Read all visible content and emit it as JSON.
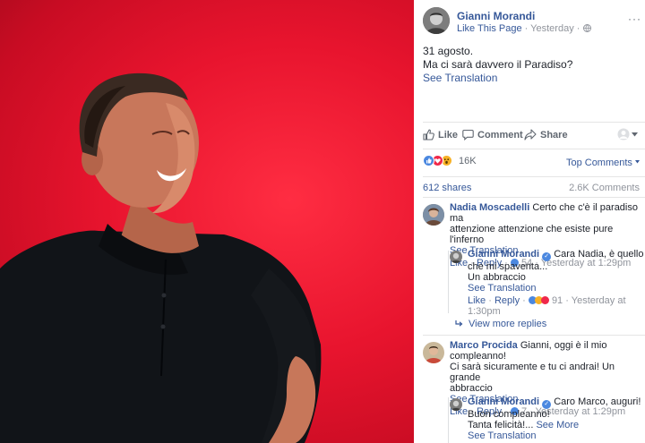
{
  "post": {
    "author": "Gianni Morandi",
    "like_page": "Like This Page",
    "time": "Yesterday",
    "dot": "·",
    "more": "···",
    "text_line1": "31 agosto.",
    "text_line2": "Ma ci sarà davvero il Paradiso?",
    "see_translation": "See Translation"
  },
  "actions": {
    "like": "Like",
    "comment": "Comment",
    "share": "Share"
  },
  "stats": {
    "reactions_count": "16K",
    "top_comments": "Top Comments",
    "shares": "612 shares",
    "comments_count": "2.6K Comments"
  },
  "comments": [
    {
      "name": "Nadia Moscadelli",
      "text_a": "Certo che c'è il paradiso ma",
      "text_b": "attenzione attenzione che esiste pure l'inferno",
      "see_translation": "See Translation",
      "like": "Like",
      "reply": "Reply",
      "reactions": "54",
      "time": "Yesterday at 1:29pm"
    },
    {
      "name": "Gianni Morandi",
      "text_a": "Cara Nadia, è quello",
      "text_b": "che mi spaventa...",
      "text_c": "Un abbraccio",
      "see_translation": "See Translation",
      "like": "Like",
      "reply": "Reply",
      "reactions": "91",
      "time_a": "Yesterday at",
      "time_b": "1:30pm"
    },
    {
      "view_more": "View more replies"
    },
    {
      "name": "Marco Procida",
      "text_a": "Gianni, oggi è il mio compleanno!",
      "text_b": "Ci sarà sicuramente e tu ci andrai! Un grande",
      "text_c": "abbraccio",
      "see_translation": "See Translation",
      "like": "Like",
      "reply": "Reply",
      "reactions": "7",
      "time": "Yesterday at 1:29pm"
    },
    {
      "name": "Gianni Morandi",
      "text_a": "Caro Marco, auguri!",
      "text_b": "Buon compleanno!",
      "text_c": "Tanta felicità!...",
      "see_more": "See More",
      "see_translation": "See Translation"
    }
  ],
  "colors": {
    "facebook_link": "#365899",
    "photo_background": "#e8142e",
    "like_blue": "#4b88e0",
    "love_red": "#f0284a",
    "wow_yellow": "#f7b125"
  }
}
